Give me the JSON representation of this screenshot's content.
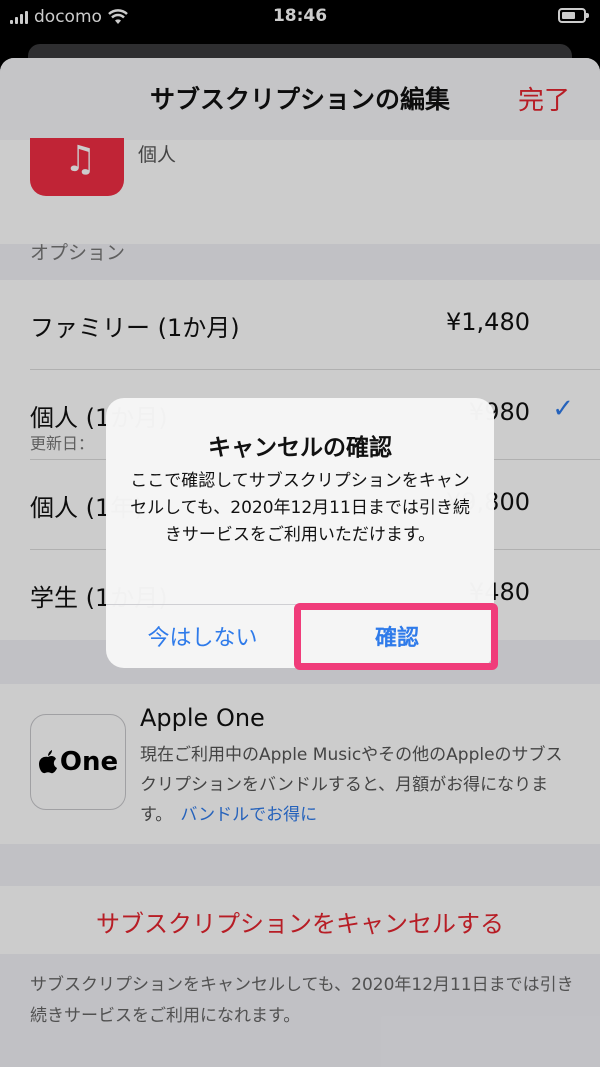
{
  "status": {
    "carrier": "docomo",
    "time": "18:46"
  },
  "nav": {
    "title": "サブスクリプションの編集",
    "done": "完了"
  },
  "header_item": {
    "label": "個人",
    "icon": "music-note-icon"
  },
  "options": {
    "section_title": "オプション",
    "items": [
      {
        "name": "ファミリー (1か月)",
        "price": "¥1,480"
      },
      {
        "name": "個人 (1か月)",
        "price": "¥980",
        "sub": "更新日：",
        "selected": true
      },
      {
        "name": "個人 (1年)",
        "price": "¥9,800"
      },
      {
        "name": "学生 (1か月)",
        "price": "¥480"
      }
    ]
  },
  "apple_one": {
    "icon_text": "One",
    "title": "Apple One",
    "description": "現在ご利用中のApple Musicやその他のAppleのサブスクリプションをバンドルすると、月額がお得になります。",
    "link": "バンドルでお得に"
  },
  "cancel": {
    "label": "サブスクリプションをキャンセルする",
    "footnote": "サブスクリプションをキャンセルしても、2020年12月11日までは引き続きサービスをご利用になれます。"
  },
  "alert": {
    "title": "キャンセルの確認",
    "message": "ここで確認してサブスクリプションをキャンセルしても、2020年12月11日までは引き続きサービスをご利用いただけます。",
    "later": "今はしない",
    "confirm": "確認"
  },
  "colors": {
    "accent_red": "#e5252f",
    "link_blue": "#2f7bea",
    "highlight": "#f03c7a"
  }
}
